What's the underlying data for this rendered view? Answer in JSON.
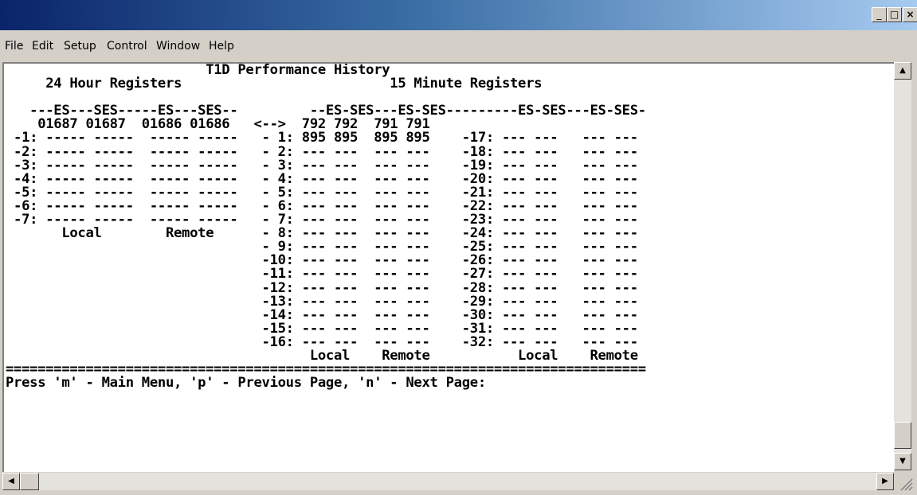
{
  "window": {
    "title": ""
  },
  "titlebar_buttons": {
    "minimize": "_",
    "maximize": "□",
    "close": "×"
  },
  "menu": [
    {
      "label": "File"
    },
    {
      "label": "Edit"
    },
    {
      "label": "Setup"
    },
    {
      "label": "Control"
    },
    {
      "label": "Window"
    },
    {
      "label": "Help"
    }
  ],
  "terminal": {
    "lines": [
      "                         T1D Performance History",
      "     24 Hour Registers                          15 Minute Registers",
      "",
      "   ---ES---SES-----ES---SES--         --ES-SES---ES-SES---------ES-SES---ES-SES-",
      "    01687 01687  01686 01686   <-->  792 792  791 791",
      " -1: ----- -----  ----- -----   - 1: 895 895  895 895    -17: --- ---   --- ---",
      " -2: ----- -----  ----- -----   - 2: --- ---  --- ---    -18: --- ---   --- ---",
      " -3: ----- -----  ----- -----   - 3: --- ---  --- ---    -19: --- ---   --- ---",
      " -4: ----- -----  ----- -----   - 4: --- ---  --- ---    -20: --- ---   --- ---",
      " -5: ----- -----  ----- -----   - 5: --- ---  --- ---    -21: --- ---   --- ---",
      " -6: ----- -----  ----- -----   - 6: --- ---  --- ---    -22: --- ---   --- ---",
      " -7: ----- -----  ----- -----   - 7: --- ---  --- ---    -23: --- ---   --- ---",
      "       Local        Remote      - 8: --- ---  --- ---    -24: --- ---   --- ---",
      "                                - 9: --- ---  --- ---    -25: --- ---   --- ---",
      "                                -10: --- ---  --- ---    -26: --- ---   --- ---",
      "                                -11: --- ---  --- ---    -27: --- ---   --- ---",
      "                                -12: --- ---  --- ---    -28: --- ---   --- ---",
      "                                -13: --- ---  --- ---    -29: --- ---   --- ---",
      "                                -14: --- ---  --- ---    -30: --- ---   --- ---",
      "                                -15: --- ---  --- ---    -31: --- ---   --- ---",
      "                                -16: --- ---  --- ---    -32: --- ---   --- ---",
      "                                      Local    Remote           Local    Remote",
      "================================================================================",
      "Press 'm' - Main Menu, 'p' - Previous Page, 'n' - Next Page:"
    ]
  },
  "scrollbar": {
    "up": "▲",
    "down": "▼",
    "left": "◀",
    "right": "▶"
  }
}
